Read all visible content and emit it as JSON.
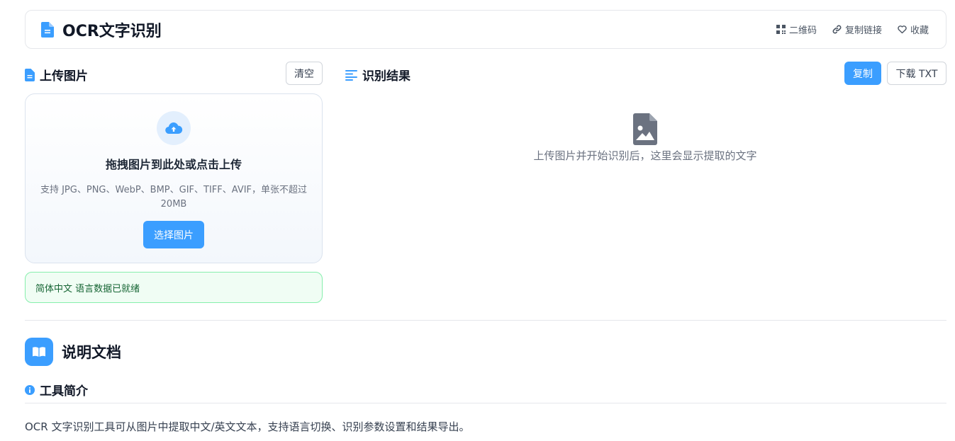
{
  "header": {
    "title": "OCR文字识别",
    "actions": [
      {
        "label": "二维码",
        "icon": "qrcode-icon"
      },
      {
        "label": "复制链接",
        "icon": "link-icon"
      },
      {
        "label": "收藏",
        "icon": "heart-icon"
      }
    ]
  },
  "upload": {
    "title": "上传图片",
    "clear_label": "清空",
    "drop_title": "拖拽图片到此处或点击上传",
    "drop_desc": "支持 JPG、PNG、WebP、BMP、GIF、TIFF、AVIF，单张不超过 20MB",
    "choose_label": "选择图片",
    "status_text": "简体中文 语言数据已就绪"
  },
  "result": {
    "title": "识别结果",
    "copy_label": "复制",
    "download_label": "下载 TXT",
    "empty_text": "上传图片并开始识别后，这里会显示提取的文字"
  },
  "docs": {
    "title": "说明文档",
    "intro_title": "工具简介",
    "intro_text": "OCR 文字识别工具可从图片中提取中文/英文文本，支持语言切换、识别参数设置和结果导出。"
  },
  "colors": {
    "accent": "#3b9eff",
    "status_bg": "#f0fdf4",
    "status_border": "#86efac",
    "status_text": "#166534"
  }
}
